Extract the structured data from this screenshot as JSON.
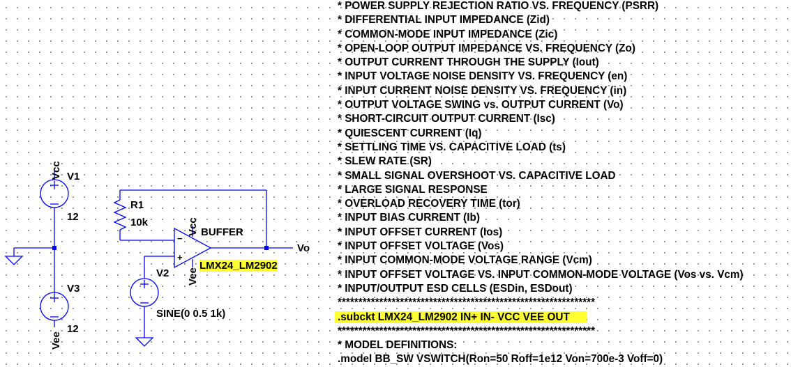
{
  "components": {
    "v1": {
      "name": "V1",
      "value": "12",
      "net_top": "Vcc"
    },
    "v3": {
      "name": "V3",
      "value": "12",
      "net_bottom": "Vee"
    },
    "v2": {
      "name": "V2",
      "value": "SINE(0 0.5 1k)"
    },
    "r1": {
      "name": "R1",
      "value": "10k"
    },
    "opamp": {
      "name": "BUFFER",
      "model": "LMX24_LM2902",
      "net_top": "Vcc",
      "net_bottom": "Vee",
      "plus": "+",
      "minus": "−"
    },
    "output_net": "Vo"
  },
  "spice_lines": [
    "* POWER SUPPLY REJECTION RATIO VS. FREQUENCY (PSRR)",
    "* DIFFERENTIAL INPUT IMPEDANCE (Zid)",
    "* COMMON-MODE INPUT IMPEDANCE (Zic)",
    "* OPEN-LOOP OUTPUT IMPEDANCE VS. FREQUENCY (Zo)",
    "* OUTPUT CURRENT THROUGH THE SUPPLY (Iout)",
    "* INPUT VOLTAGE NOISE DENSITY VS. FREQUENCY (en)",
    "* INPUT CURRENT NOISE DENSITY VS. FREQUENCY (in)",
    "* OUTPUT VOLTAGE SWING vs. OUTPUT CURRENT (Vo)",
    "* SHORT-CIRCUIT OUTPUT CURRENT (Isc)",
    "* QUIESCENT CURRENT (Iq)",
    "* SETTLING TIME VS. CAPACITIVE LOAD (ts)",
    "* SLEW RATE (SR)",
    "* SMALL SIGNAL OVERSHOOT VS. CAPACITIVE LOAD",
    "* LARGE SIGNAL RESPONSE",
    "* OVERLOAD RECOVERY TIME (tor)",
    "* INPUT BIAS CURRENT (Ib)",
    "* INPUT OFFSET CURRENT (Ios)",
    "* INPUT OFFSET VOLTAGE (Vos)",
    "* INPUT COMMON-MODE VOLTAGE RANGE (Vcm)",
    "* INPUT OFFSET VOLTAGE VS. INPUT COMMON-MODE VOLTAGE (Vos vs. Vcm)",
    "* INPUT/OUTPUT ESD CELLS (ESDin, ESDout)",
    "**************************************************************",
    ".subckt LMX24_LM2902 IN+ IN- VCC VEE OUT",
    "**************************************************************",
    "* MODEL DEFINITIONS:",
    ".model BB_SW VSWITCH(Ron=50 Roff=1e12 Von=700e-3 Voff=0)"
  ],
  "colors": {
    "wire": "#0000ff",
    "component": "#0000ff",
    "highlight": "#ffff33",
    "grid_dot": "#7a7a7a"
  }
}
